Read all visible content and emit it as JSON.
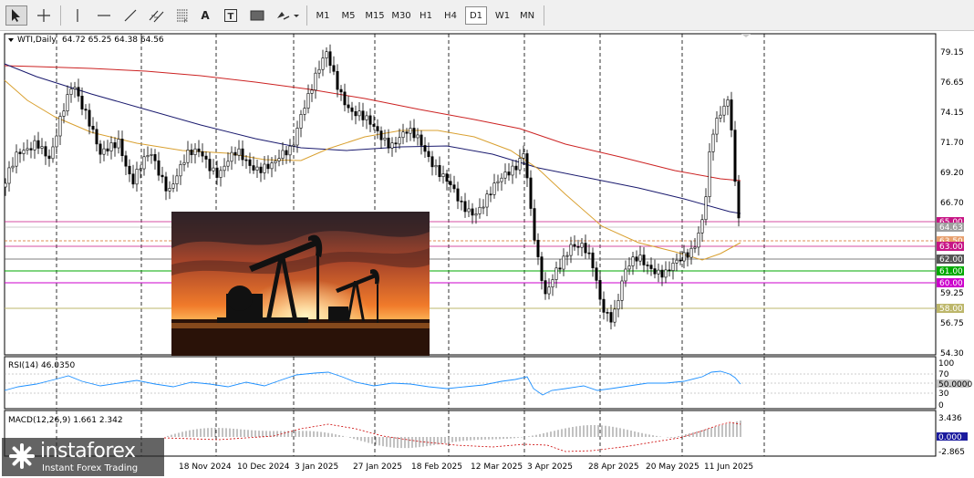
{
  "toolbar": {
    "tools": [
      {
        "name": "cursor-icon",
        "glyph": "↖"
      },
      {
        "name": "crosshair-icon",
        "glyph": "+"
      },
      {
        "name": "vertical-line-icon",
        "glyph": "|"
      },
      {
        "name": "horizontal-line-icon",
        "glyph": "—"
      },
      {
        "name": "trendline-icon",
        "glyph": "╱"
      },
      {
        "name": "channel-icon",
        "glyph": "⫽"
      },
      {
        "name": "fibonacci-icon",
        "glyph": "≡"
      },
      {
        "name": "text-icon",
        "glyph": "A"
      },
      {
        "name": "text-label-icon",
        "glyph": "T"
      },
      {
        "name": "rectangle-icon",
        "glyph": "▬"
      },
      {
        "name": "shapes-dropdown-icon",
        "glyph": "⬦▾"
      }
    ],
    "timeframes": [
      "M1",
      "M5",
      "M15",
      "M30",
      "H1",
      "H4",
      "D1",
      "W1",
      "MN"
    ],
    "active_timeframe": "D1"
  },
  "main": {
    "symbol_label": "WTI,Daily",
    "ohlc": "64.72 65.25 64.38 64.56",
    "price_axis": [
      "79.15",
      "76.65",
      "74.15",
      "71.70",
      "69.20",
      "66.70",
      "59.25",
      "56.75",
      "54.30"
    ],
    "level_labels": [
      {
        "text": "65.00",
        "color": "#c71585"
      },
      {
        "text": "64.63",
        "color": "#9e9e9e"
      },
      {
        "text": "63.50",
        "color": "#e8a06e"
      },
      {
        "text": "63.00",
        "color": "#c71585"
      },
      {
        "text": "62.00",
        "color": "#555555"
      },
      {
        "text": "61.00",
        "color": "#00aa00"
      },
      {
        "text": "60.00",
        "color": "#cc00cc"
      },
      {
        "text": "58.00",
        "color": "#bdb76b"
      }
    ]
  },
  "rsi": {
    "label": "RSI(14) 46.0350",
    "levels": [
      "100",
      "70",
      "50.0000",
      "30",
      "0"
    ]
  },
  "macd": {
    "label": "MACD(12,26,9) 1.661 2.342",
    "levels": [
      "3.436",
      "0.000",
      "-2.865"
    ]
  },
  "date_axis": [
    "18 Nov 2024",
    "10 Dec 2024",
    "3 Jan 2025",
    "27 Jan 2025",
    "18 Feb 2025",
    "12 Mar 2025",
    "3 Apr 2025",
    "28 Apr 2025",
    "20 May 2025",
    "11 Jun 2025"
  ],
  "watermark": {
    "brand": "instaforex",
    "tagline": "Instant Forex Trading"
  }
}
